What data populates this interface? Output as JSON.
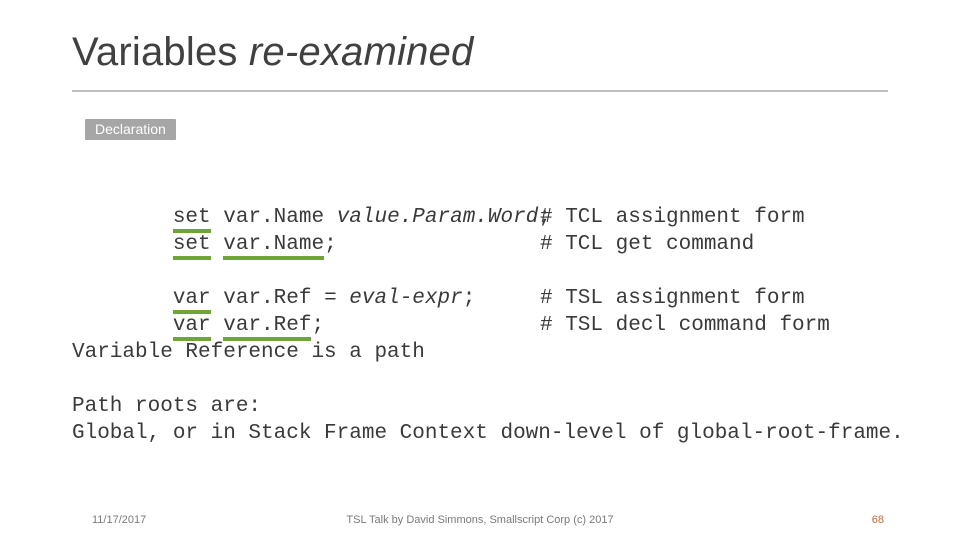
{
  "title": {
    "plain": "Variables ",
    "italic": "re-examined"
  },
  "declaration_label": "Declaration",
  "code": {
    "l1": {
      "kw": "set",
      "varname": "var.Name",
      "value": "value.Param.Word",
      "semi": ";",
      "comment": "# TCL assignment form"
    },
    "l2": {
      "kw": "set",
      "varname": "var.Name",
      "semi": ";",
      "comment": "# TCL get command"
    },
    "l3": {
      "kw": "var",
      "varname": "var.Ref",
      "eq": " = ",
      "value": "eval-expr",
      "semi": ";",
      "comment": "# TSL assignment form"
    },
    "l4": {
      "kw": "var",
      "varname": "var.Ref",
      "semi": ";",
      "comment": "# TSL decl command form"
    },
    "l5": "Variable Reference is a path",
    "l6": "Path roots are:",
    "l7": "Global, or in Stack Frame Context down-level of global-root-frame."
  },
  "footer": {
    "date": "11/17/2017",
    "center": "TSL Talk by David Simmons, Smallscript Corp (c) 2017",
    "page": "68"
  }
}
